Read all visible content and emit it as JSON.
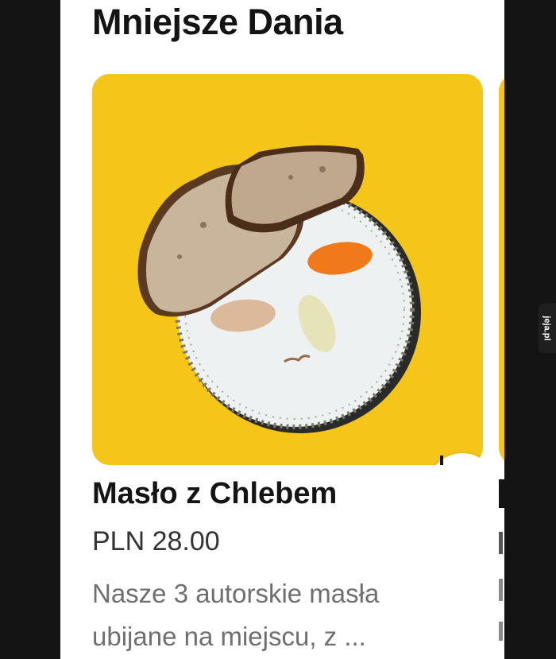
{
  "section": {
    "title": "Mniejsze Dania"
  },
  "item": {
    "name": "Masło z Chlebem",
    "price": "PLN 28.00",
    "description": "Nasze 3 autorskie masła ubijane na miejscu, z ...",
    "image_icon": "bread-butter-plate-image",
    "add_icon": "plus-icon"
  },
  "watermark": {
    "text": "jeja.pl"
  },
  "colors": {
    "card_background": "#f5c518",
    "accent_orange": "#f07a1a",
    "page_background": "#141414"
  }
}
